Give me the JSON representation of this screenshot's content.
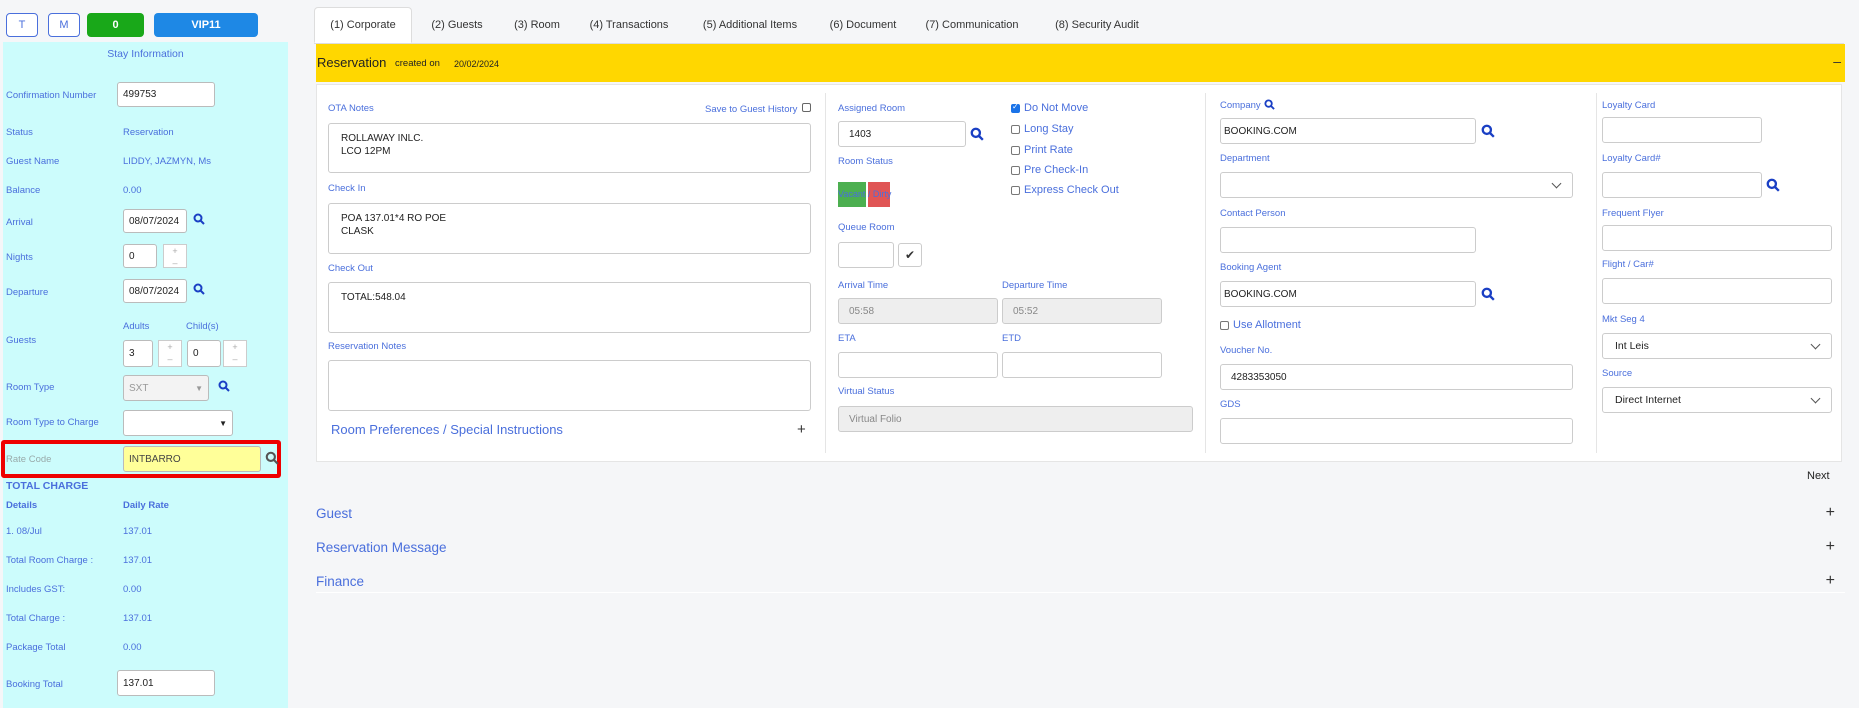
{
  "top_buttons": {
    "t": "T",
    "m": "M",
    "count": "0",
    "vip": "VIP11"
  },
  "stay": {
    "title": "Stay Information",
    "confirmation_label": "Confirmation Number",
    "confirmation_value": "499753",
    "status_label": "Status",
    "status_value": "Reservation",
    "guest_name_label": "Guest Name",
    "guest_name_value": "LIDDY, JAZMYN, Ms",
    "balance_label": "Balance",
    "balance_value": "0.00",
    "arrival_label": "Arrival",
    "arrival_value": "08/07/2024",
    "nights_label": "Nights",
    "nights_value": "0",
    "departure_label": "Departure",
    "departure_value": "08/07/2024",
    "adults_label": "Adults",
    "children_label": "Child(s)",
    "guests_label": "Guests",
    "adults_value": "3",
    "children_value": "0",
    "room_type_label": "Room Type",
    "room_type_value": "SXT",
    "room_type_charge_label": "Room Type to Charge",
    "rate_code_label": "Rate Code",
    "rate_code_value": "INTBARRO",
    "total_charge_heading": "TOTAL CHARGE",
    "details_header": "Details",
    "daily_rate_header": "Daily Rate",
    "line1_label": "1. 08/Jul",
    "line1_value": "137.01",
    "total_room_charge_label": "Total Room Charge :",
    "total_room_charge_value": "137.01",
    "includes_gst_label": "Includes GST:",
    "includes_gst_value": "0.00",
    "total_charge_label": "Total Charge :",
    "total_charge_value": "137.01",
    "package_total_label": "Package Total",
    "package_total_value": "0.00",
    "booking_total_label": "Booking Total",
    "booking_total_value": "137.01"
  },
  "tabs": [
    "(1) Corporate",
    "(2) Guests",
    "(3) Room",
    "(4) Transactions",
    "(5) Additional Items",
    "(6) Document",
    "(7) Communication",
    "(8) Security Audit"
  ],
  "reservation": {
    "title": "Reservation",
    "created_on_label": "created on",
    "created_on_value": "20/02/2024",
    "collapse": "–"
  },
  "notes": {
    "ota_label": "OTA Notes",
    "save_history_label": "Save to Guest History",
    "ota_value": "ROLLAWAY INLC.\nLCO 12PM",
    "checkin_label": "Check In",
    "checkin_value": "POA 137.01*4 RO POE\nCLASK",
    "checkout_label": "Check Out",
    "checkout_value": "TOTAL:548.04",
    "res_notes_label": "Reservation Notes",
    "res_notes_value": "",
    "preferences_label": "Room Preferences / Special Instructions",
    "preferences_toggle": "+"
  },
  "room": {
    "assigned_label": "Assigned Room",
    "assigned_value": "1403",
    "status_label": "Room Status",
    "status_text": "Vacant / Dirty",
    "queue_label": "Queue Room",
    "arrival_time_label": "Arrival Time",
    "arrival_time_value": "05:58",
    "departure_time_label": "Departure Time",
    "departure_time_value": "05:52",
    "eta_label": "ETA",
    "etd_label": "ETD",
    "virtual_label": "Virtual Status",
    "virtual_value": "Virtual Folio",
    "do_not_move": "Do Not Move",
    "long_stay": "Long Stay",
    "print_rate": "Print Rate",
    "pre_checkin": "Pre Check-In",
    "express_checkout": "Express Check Out"
  },
  "company": {
    "company_label": "Company",
    "company_value": "BOOKING.COM",
    "department_label": "Department",
    "contact_label": "Contact Person",
    "agent_label": "Booking Agent",
    "agent_value": "BOOKING.COM",
    "use_allotment": "Use Allotment",
    "voucher_label": "Voucher No.",
    "voucher_value": "4283353050",
    "gds_label": "GDS"
  },
  "loyalty": {
    "card_label": "Loyalty Card",
    "card_no_label": "Loyalty Card#",
    "flyer_label": "Frequent Flyer",
    "flight_label": "Flight / Car#",
    "mkt_label": "Mkt Seg 4",
    "mkt_value": "Int Leis",
    "source_label": "Source",
    "source_value": "Direct Internet"
  },
  "next_label": "Next",
  "sections": [
    {
      "title": "Guest",
      "toggle": "+"
    },
    {
      "title": "Reservation Message",
      "toggle": "+"
    },
    {
      "title": "Finance",
      "toggle": "+"
    }
  ],
  "colors": {
    "accent": "#4a6fdc",
    "reservation_bar": "#ffd700",
    "left_panel": "#ccfcfc",
    "highlight": "#ff0000"
  }
}
